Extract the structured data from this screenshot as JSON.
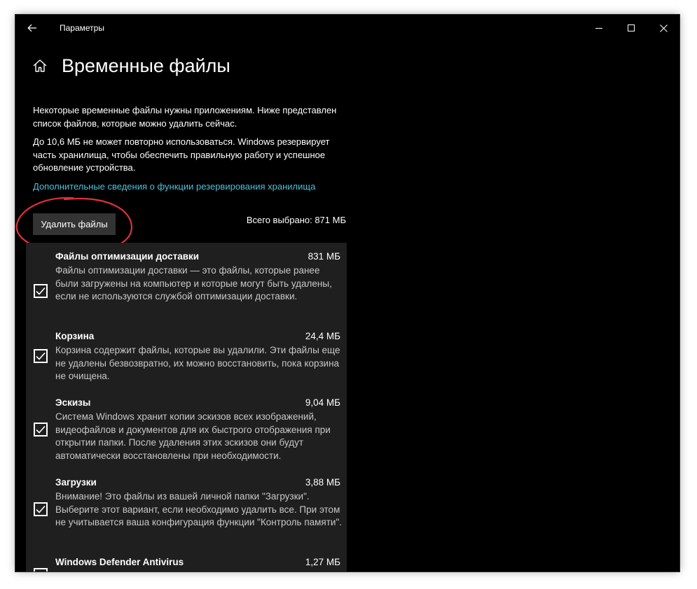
{
  "window": {
    "app_title": "Параметры"
  },
  "icons": {
    "back": "back-arrow-icon",
    "home": "home-icon",
    "minimize": "minimize-icon",
    "maximize": "maximize-icon",
    "close": "close-icon",
    "check": "checkmark-icon"
  },
  "colors": {
    "background": "#000000",
    "panel": "#1f1f1f",
    "link": "#4cc2d8",
    "annotation": "#e0303a",
    "button": "#333333"
  },
  "page": {
    "title": "Временные файлы",
    "desc1": "Некоторые временные файлы нужны приложениям. Ниже представлен список файлов, которые можно удалить сейчас.",
    "desc2": "До 10,6 МБ не может повторно использоваться. Windows резервирует часть хранилища, чтобы обеспечить правильную работу и успешное обновление устройства.",
    "more_link": "Дополнительные сведения о функции резервирования хранилища",
    "delete_button": "Удалить файлы",
    "total_selected": "Всего выбрано: 871 МБ"
  },
  "items": [
    {
      "title": "Файлы оптимизации доставки",
      "size": "831 МБ",
      "checked": true,
      "desc": "Файлы оптимизации доставки — это файлы, которые ранее были загружены на компьютер и которые могут быть удалены, если не используются службой оптимизации доставки."
    },
    {
      "title": "Корзина",
      "size": "24,4 МБ",
      "checked": true,
      "desc": "Корзина содержит файлы, которые вы удалили. Эти файлы еще не удалены безвозвратно, их можно восстановить, пока корзина не очищена."
    },
    {
      "title": "Эскизы",
      "size": "9,04 МБ",
      "checked": true,
      "desc": "Система Windows хранит копии эскизов всех изображений, видеофайлов и документов для их быстрого отображения при открытии папки. После удаления этих эскизов они будут автоматически восстановлены при необходимости."
    },
    {
      "title": "Загрузки",
      "size": "3,88 МБ",
      "checked": true,
      "desc": "Внимание! Это файлы из вашей личной папки \"Загрузки\". Выберите этот вариант, если необходимо удалить все. При этом не учитывается ваша конфигурация функции \"Контроль памяти\"."
    },
    {
      "title": "Windows Defender Antivirus",
      "size": "1,27 МБ",
      "checked": false,
      "desc": ""
    }
  ]
}
